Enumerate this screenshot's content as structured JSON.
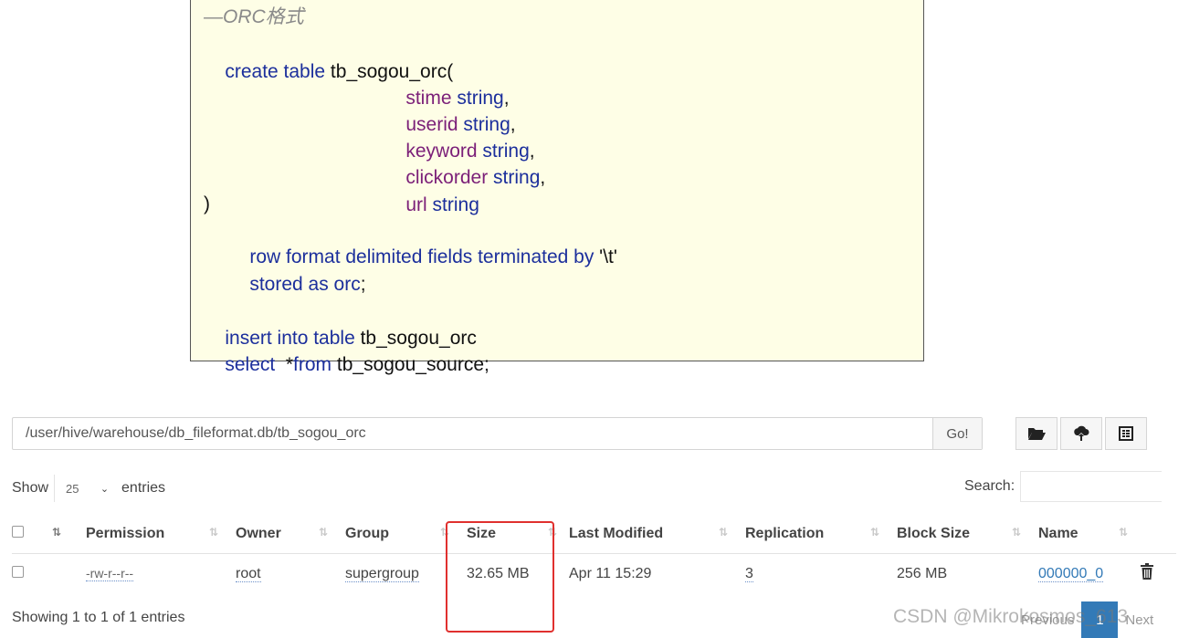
{
  "code": {
    "comment": "—ORC格式",
    "line1": {
      "kw": "create table",
      "rest": " tb_sogou_orc("
    },
    "fields": [
      {
        "name": "stime",
        "type": "string",
        "sep": ","
      },
      {
        "name": "userid",
        "type": "string",
        "sep": ","
      },
      {
        "name": "keyword",
        "type": "string",
        "sep": ","
      },
      {
        "name": "clickorder",
        "type": "string",
        "sep": ","
      },
      {
        "name": "url",
        "type": "string",
        "sep": ""
      }
    ],
    "close_paren": ")",
    "row_format": {
      "kw": "row format delimited fields terminated by",
      "rest": " '\\t'"
    },
    "stored": {
      "kw": "stored as orc",
      "rest": ";"
    },
    "insert": {
      "kw": "insert into table",
      "rest": " tb_sogou_orc"
    },
    "select": {
      "kw1": "select",
      "mid": "  *",
      "kw2": "from",
      "rest": " tb_sogou_source;"
    }
  },
  "browser": {
    "path": "/user/hive/warehouse/db_fileformat.db/tb_sogou_orc",
    "go_label": "Go!",
    "show_label": "Show",
    "entries_value": "25",
    "entries_label": "entries",
    "search_label": "Search:",
    "columns": [
      "Permission",
      "Owner",
      "Group",
      "Size",
      "Last Modified",
      "Replication",
      "Block Size",
      "Name"
    ],
    "rows": [
      {
        "permission": "-rw-r--r--",
        "owner": "root",
        "group": "supergroup",
        "size": "32.65 MB",
        "modified": "Apr 11 15:29",
        "replication": "3",
        "block_size": "256 MB",
        "name": "000000_0"
      }
    ],
    "footer": "Showing 1 to 1 of 1 entries",
    "pager": {
      "previous": "Previous",
      "page": "1",
      "next": "Next"
    }
  },
  "watermark": "CSDN @Mikrokosmos_613",
  "colors": {
    "accent": "#337ab7",
    "highlight": "#e0302e",
    "code_bg": "#fefee6"
  }
}
